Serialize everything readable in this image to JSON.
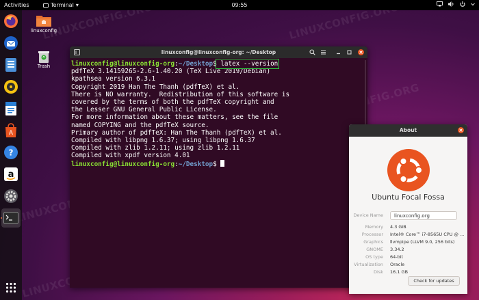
{
  "topbar": {
    "activities": "Activities",
    "app_name": "Terminal",
    "app_arrow": "▾",
    "clock": "09:55"
  },
  "desktop": {
    "icons": [
      {
        "label": "linuxconfig"
      },
      {
        "label": "Trash"
      }
    ],
    "watermark": "LINUXCONFIG.ORG"
  },
  "dock": {
    "items": [
      "firefox",
      "thunderbird",
      "files",
      "rhythmbox",
      "libreoffice-writer",
      "software",
      "help",
      "amazon",
      "settings",
      "terminal"
    ],
    "show_apps": "show-applications"
  },
  "terminal": {
    "title": "linuxconfig@linuxconfig-org: ~/Desktop",
    "prompt_user": "linuxconfig@linuxconfig-org",
    "prompt_sep": ":",
    "prompt_path": "~/Desktop",
    "prompt_dollar": "$",
    "command": " latex --version",
    "output": [
      "pdfTeX 3.14159265-2.6-1.40.20 (TeX Live 2019/Debian)",
      "kpathsea version 6.3.1",
      "Copyright 2019 Han The Thanh (pdfTeX) et al.",
      "There is NO warranty.  Redistribution of this software is",
      "covered by the terms of both the pdfTeX copyright and",
      "the Lesser GNU General Public License.",
      "For more information about these matters, see the file",
      "named COPYING and the pdfTeX source.",
      "Primary author of pdfTeX: Han The Thanh (pdfTeX) et al.",
      "Compiled with libpng 1.6.37; using libpng 1.6.37",
      "Compiled with zlib 1.2.11; using zlib 1.2.11",
      "Compiled with xpdf version 4.01"
    ]
  },
  "about": {
    "title": "About",
    "os_name": "Ubuntu Focal Fossa",
    "device_label": "Device Name",
    "device_name": "linuxconfig.org",
    "rows": [
      {
        "key": "Memory",
        "value": "4.3 GiB"
      },
      {
        "key": "Processor",
        "value": "Intel® Core™ i7-8565U CPU @ ..."
      },
      {
        "key": "Graphics",
        "value": "llvmpipe (LLVM 9.0, 256 bits)"
      },
      {
        "key": "GNOME",
        "value": "3.34.2"
      },
      {
        "key": "OS type",
        "value": "64-bit"
      },
      {
        "key": "Virtualization",
        "value": "Oracle"
      },
      {
        "key": "Disk",
        "value": "16.1 GB"
      }
    ],
    "check_button": "Check for updates"
  },
  "colors": {
    "accent": "#e95420",
    "terminal_bg": "#300a24",
    "prompt_green": "#8ae234",
    "prompt_blue": "#729fcf",
    "highlight_box": "#2ecc40"
  }
}
